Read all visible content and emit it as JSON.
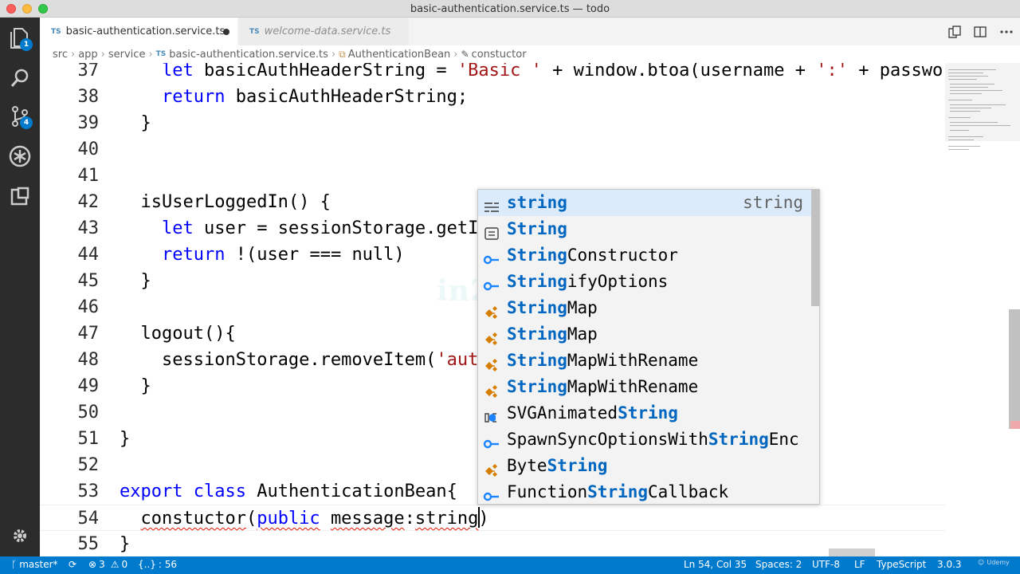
{
  "window": {
    "title": "basic-authentication.service.ts — todo"
  },
  "activity_bar": {
    "explorer_badge": "1",
    "scm_badge": "4"
  },
  "tabs": [
    {
      "label": "basic-authentication.service.ts",
      "lang": "TS",
      "dirty": true,
      "active": true
    },
    {
      "label": "welcome-data.service.ts",
      "lang": "TS",
      "active": false
    }
  ],
  "breadcrumbs": {
    "items": [
      "src",
      "app",
      "service",
      "basic-authentication.service.ts",
      "AuthenticationBean",
      "constuctor"
    ],
    "lang": "TS"
  },
  "editor": {
    "lines": [
      {
        "n": "37",
        "t": "    let basicAuthHeaderString = 'Basic ' + window.btoa(username + ':' + passwo"
      },
      {
        "n": "38",
        "t": "    return basicAuthHeaderString;"
      },
      {
        "n": "39",
        "t": "  }"
      },
      {
        "n": "40",
        "t": ""
      },
      {
        "n": "41",
        "t": ""
      },
      {
        "n": "42",
        "t": "  isUserLoggedIn() {"
      },
      {
        "n": "43",
        "t": "    let user = sessionStorage.getI"
      },
      {
        "n": "44",
        "t": "    return !(user === null)"
      },
      {
        "n": "45",
        "t": "  }"
      },
      {
        "n": "46",
        "t": ""
      },
      {
        "n": "47",
        "t": "  logout(){"
      },
      {
        "n": "48",
        "t": "    sessionStorage.removeItem('aut"
      },
      {
        "n": "49",
        "t": "  }"
      },
      {
        "n": "50",
        "t": ""
      },
      {
        "n": "51",
        "t": "}"
      },
      {
        "n": "52",
        "t": ""
      },
      {
        "n": "53",
        "t": "export class AuthenticationBean{"
      },
      {
        "n": "54",
        "t": "  constuctor(public message:string)"
      },
      {
        "n": "55",
        "t": "}"
      }
    ]
  },
  "suggest": {
    "detail": "string",
    "items": [
      {
        "pre": "",
        "hl": "string",
        "post": "",
        "icon": "keyword-icon"
      },
      {
        "pre": "",
        "hl": "String",
        "post": "",
        "icon": "enum-icon"
      },
      {
        "pre": "",
        "hl": "String",
        "post": "Constructor",
        "icon": "interface-icon"
      },
      {
        "pre": "",
        "hl": "String",
        "post": "ifyOptions",
        "icon": "interface-icon"
      },
      {
        "pre": "",
        "hl": "String",
        "post": "Map",
        "icon": "class-icon"
      },
      {
        "pre": "",
        "hl": "String",
        "post": "Map",
        "icon": "class-icon"
      },
      {
        "pre": "",
        "hl": "String",
        "post": "MapWithRename",
        "icon": "class-icon"
      },
      {
        "pre": "",
        "hl": "String",
        "post": "MapWithRename",
        "icon": "class-icon"
      },
      {
        "pre": "SVGAnimated",
        "hl": "String",
        "post": "",
        "icon": "variable-icon"
      },
      {
        "pre": "SpawnSyncOptionsWith",
        "hl": "String",
        "post": "Enc",
        "icon": "interface-icon"
      },
      {
        "pre": "Byte",
        "hl": "String",
        "post": "",
        "icon": "class-icon"
      },
      {
        "pre": "Function",
        "hl": "String",
        "post": "Callback",
        "icon": "interface-icon"
      }
    ]
  },
  "watermark": "in28minutes",
  "status": {
    "branch": "master*",
    "errors": "3",
    "warnings": "0",
    "braces": "{..}",
    "col_count": ": 56",
    "position": "Ln 54, Col 35",
    "spaces": "Spaces: 2",
    "encoding": "UTF-8",
    "eol": "LF",
    "language": "TypeScript",
    "ts_version": "3.0.3",
    "udemy": "Udemy"
  },
  "colors": {
    "statusbar": "#007acc",
    "activitybar": "#2c2c2c",
    "keyword": "#0000ff",
    "string": "#a31515",
    "suggest_highlight": "#0066bf"
  }
}
